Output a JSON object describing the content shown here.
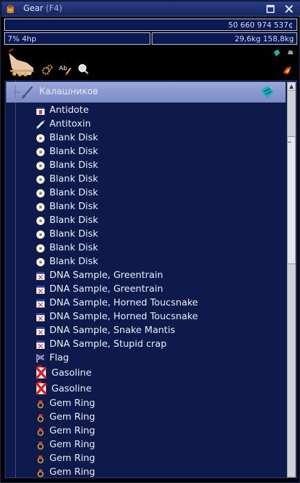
{
  "window": {
    "title": "Gear",
    "hotkey": "(F4)"
  },
  "status": {
    "money": "50 660 974 537¢",
    "left": "7% 4hp",
    "right": "29,6kg 158,8kg"
  },
  "group": {
    "label": "Калашников"
  },
  "items": [
    {
      "label": "Antidote",
      "icon": "antidote-icon"
    },
    {
      "label": "Antitoxin",
      "icon": "syringe-icon"
    },
    {
      "label": "Blank Disk",
      "icon": "disk-icon"
    },
    {
      "label": "Blank Disk",
      "icon": "disk-icon"
    },
    {
      "label": "Blank Disk",
      "icon": "disk-icon"
    },
    {
      "label": "Blank Disk",
      "icon": "disk-icon"
    },
    {
      "label": "Blank Disk",
      "icon": "disk-icon"
    },
    {
      "label": "Blank Disk",
      "icon": "disk-icon"
    },
    {
      "label": "Blank Disk",
      "icon": "disk-icon"
    },
    {
      "label": "Blank Disk",
      "icon": "disk-icon"
    },
    {
      "label": "Blank Disk",
      "icon": "disk-icon"
    },
    {
      "label": "Blank Disk",
      "icon": "disk-icon"
    },
    {
      "label": "DNA Sample, Greentrain",
      "icon": "dna-sample-icon"
    },
    {
      "label": "DNA Sample, Greentrain",
      "icon": "dna-sample-icon"
    },
    {
      "label": "DNA Sample, Horned Toucsnake",
      "icon": "dna-sample-icon"
    },
    {
      "label": "DNA Sample, Horned Toucsnake",
      "icon": "dna-sample-icon"
    },
    {
      "label": "DNA Sample, Snake Mantis",
      "icon": "dna-sample-icon"
    },
    {
      "label": "DNA Sample, Stupid crap",
      "icon": "dna-sample-icon"
    },
    {
      "label": "Flag",
      "icon": "flag-icon"
    },
    {
      "label": "Gasoline",
      "icon": "gas-can-icon"
    },
    {
      "label": "Gasoline",
      "icon": "gas-can-icon"
    },
    {
      "label": "Gem Ring",
      "icon": "gem-ring-icon"
    },
    {
      "label": "Gem Ring",
      "icon": "gem-ring-icon"
    },
    {
      "label": "Gem Ring",
      "icon": "gem-ring-icon"
    },
    {
      "label": "Gem Ring",
      "icon": "gem-ring-icon"
    },
    {
      "label": "Gem Ring",
      "icon": "gem-ring-icon"
    },
    {
      "label": "Gem Ring",
      "icon": "gem-ring-icon"
    }
  ],
  "colors": {
    "list_bg": "#0e1a4c",
    "selected_row": "#8e9bd2",
    "titlebar": "#22357a"
  }
}
